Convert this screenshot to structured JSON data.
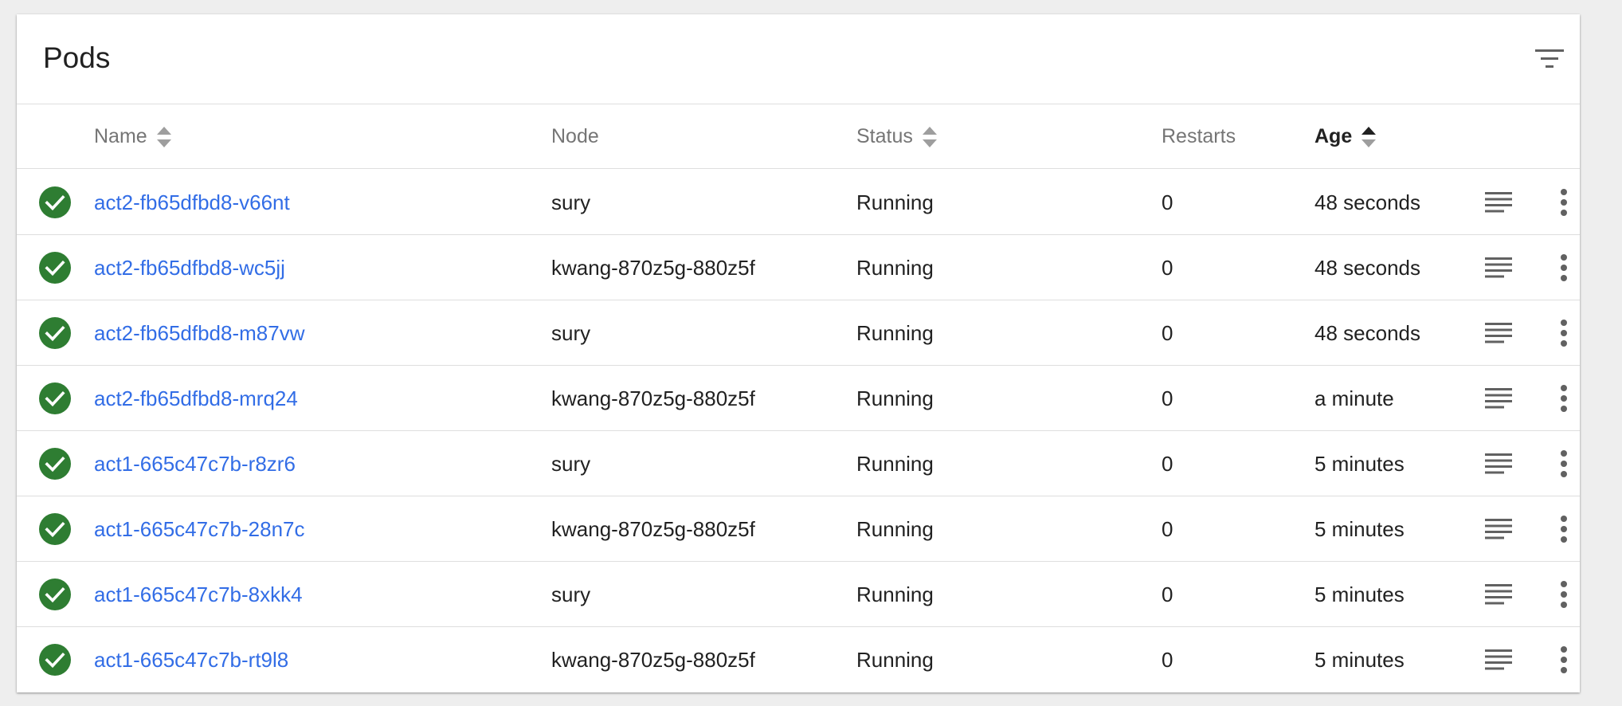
{
  "card": {
    "title": "Pods",
    "filter_icon": "filter-list-icon"
  },
  "columns": {
    "name": "Name",
    "node": "Node",
    "status": "Status",
    "restarts": "Restarts",
    "age": "Age",
    "sorted_by": "Age",
    "sort_direction": "ascending"
  },
  "colors": {
    "link": "#326de6",
    "status_ok": "#2e7d32",
    "text": "#212121",
    "header_text": "#757575"
  },
  "rows": [
    {
      "name": "act2-fb65dfbd8-v66nt",
      "node": "sury",
      "status": "Running",
      "restarts": "0",
      "age": "48 seconds"
    },
    {
      "name": "act2-fb65dfbd8-wc5jj",
      "node": "kwang-870z5g-880z5f",
      "status": "Running",
      "restarts": "0",
      "age": "48 seconds"
    },
    {
      "name": "act2-fb65dfbd8-m87vw",
      "node": "sury",
      "status": "Running",
      "restarts": "0",
      "age": "48 seconds"
    },
    {
      "name": "act2-fb65dfbd8-mrq24",
      "node": "kwang-870z5g-880z5f",
      "status": "Running",
      "restarts": "0",
      "age": "a minute"
    },
    {
      "name": "act1-665c47c7b-r8zr6",
      "node": "sury",
      "status": "Running",
      "restarts": "0",
      "age": "5 minutes"
    },
    {
      "name": "act1-665c47c7b-28n7c",
      "node": "kwang-870z5g-880z5f",
      "status": "Running",
      "restarts": "0",
      "age": "5 minutes"
    },
    {
      "name": "act1-665c47c7b-8xkk4",
      "node": "sury",
      "status": "Running",
      "restarts": "0",
      "age": "5 minutes"
    },
    {
      "name": "act1-665c47c7b-rt9l8",
      "node": "kwang-870z5g-880z5f",
      "status": "Running",
      "restarts": "0",
      "age": "5 minutes"
    }
  ],
  "row_icons": {
    "status": "check-circle-icon",
    "logs": "logs-icon",
    "menu": "more-vert-icon"
  }
}
